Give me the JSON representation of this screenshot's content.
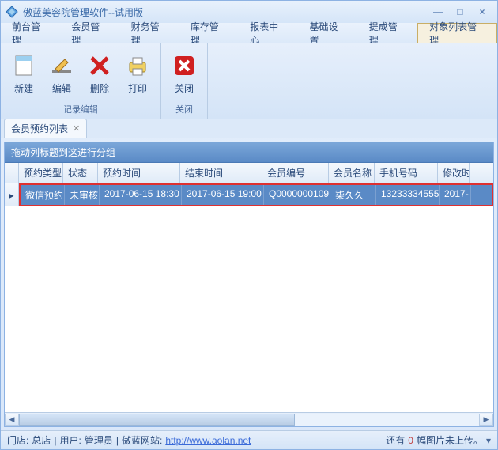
{
  "window": {
    "title": "傲蓝美容院管理软件--试用版"
  },
  "menu": {
    "items": [
      "前台管理",
      "会员管理",
      "财务管理",
      "库存管理",
      "报表中心",
      "基础设置",
      "提成管理",
      "对象列表管理"
    ],
    "active_index": 7
  },
  "ribbon": {
    "groups": [
      {
        "label": "记录编辑",
        "buttons": [
          {
            "id": "new",
            "label": "新建"
          },
          {
            "id": "edit",
            "label": "编辑"
          },
          {
            "id": "delete",
            "label": "删除"
          },
          {
            "id": "print",
            "label": "打印"
          }
        ]
      },
      {
        "label": "关闭",
        "buttons": [
          {
            "id": "close",
            "label": "关闭"
          }
        ]
      }
    ]
  },
  "tab": {
    "label": "会员预约列表"
  },
  "grid": {
    "group_hint": "拖动列标题到这进行分组",
    "columns": [
      "预约类型",
      "状态",
      "预约时间",
      "结束时间",
      "会员编号",
      "会员名称",
      "手机号码",
      "修改时"
    ],
    "row": {
      "type": "微信预约",
      "status": "未审核",
      "start": "2017-06-15 18:30",
      "end": "2017-06-15 19:00",
      "member_no": "Q0000000109",
      "member_name": "柒久久",
      "phone": "13233334555",
      "modified": "2017-"
    }
  },
  "status": {
    "store_label": "门店:",
    "store": "总店",
    "user_label": "用户:",
    "user": "管理员",
    "site_label": "傲蓝网站:",
    "site_url": "http://www.aolan.net",
    "upload_prefix": "还有",
    "upload_count": "0",
    "upload_suffix": "幅图片未上传。"
  }
}
